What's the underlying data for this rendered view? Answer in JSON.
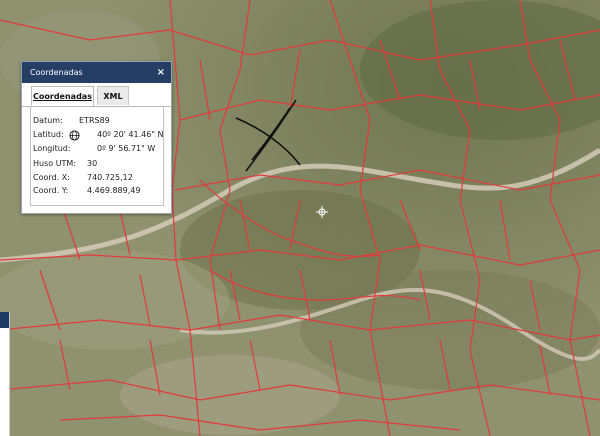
{
  "map": {
    "cursor_icon": "crosshair-icon",
    "parcel_line_color": "#e23a3a"
  },
  "panel": {
    "title": "Coordenadas",
    "close_label": "×",
    "tabs": [
      {
        "label": "Coordenadas",
        "active": true
      },
      {
        "label": "XML",
        "active": false
      }
    ],
    "fields": [
      {
        "label": "Datum:",
        "value": "ETRS89"
      },
      {
        "label": "Latitud:",
        "value": "40º 20' 41.46\" N"
      },
      {
        "label": "Longitud:",
        "value": "0º 9' 56.71\" W"
      },
      {
        "label": "Huso UTM:",
        "value": "30"
      },
      {
        "label": "Coord. X:",
        "value": "740.725,12"
      },
      {
        "label": "Coord. Y:",
        "value": "4.469.889,49"
      }
    ],
    "header_color": "#243e66"
  }
}
